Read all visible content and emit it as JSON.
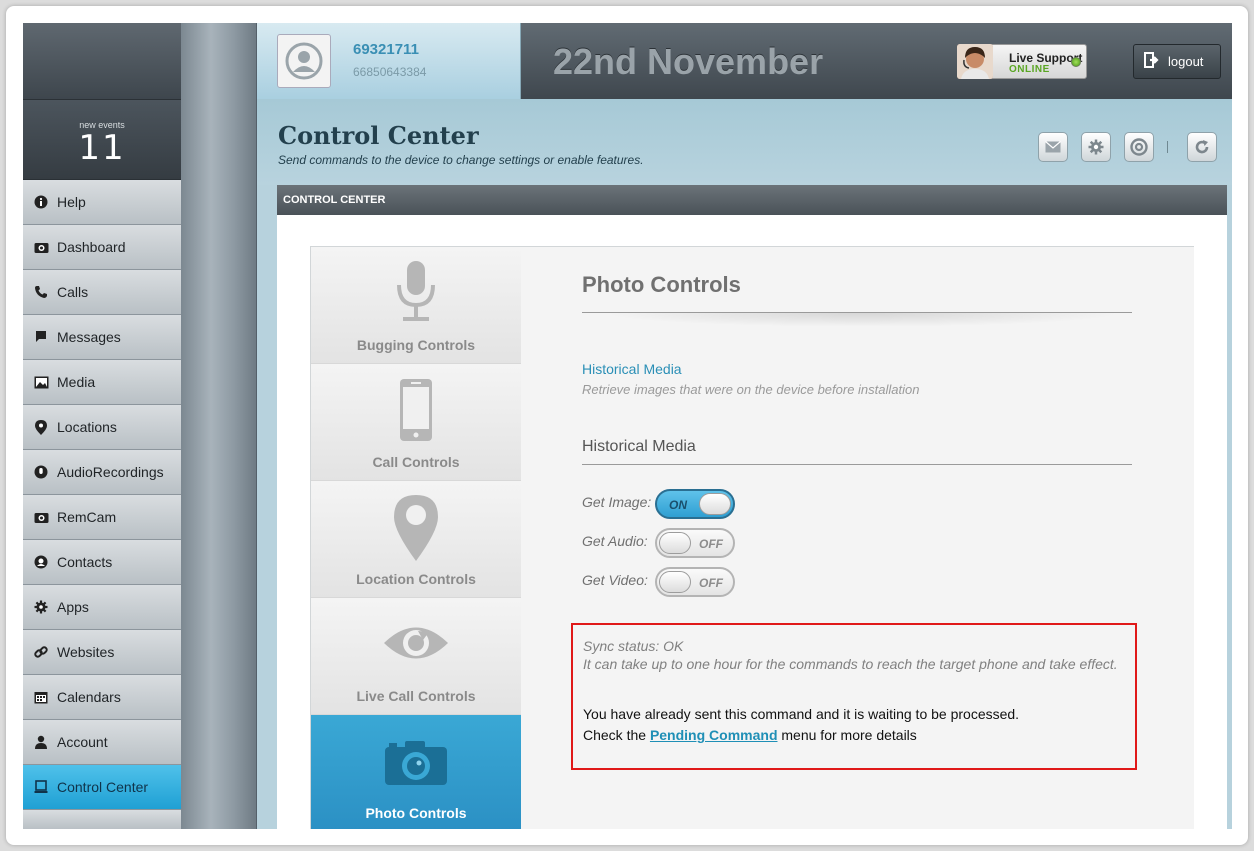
{
  "header": {
    "username": "69321711",
    "phone": "66850643384",
    "date_title": "22nd November",
    "support_line1": "Live Support",
    "support_line2": "ONLINE",
    "logout_label": "logout"
  },
  "sidebar": {
    "events_label": "new events",
    "events_count": "11",
    "items": [
      {
        "label": "Help",
        "icon": "info-icon"
      },
      {
        "label": "Dashboard",
        "icon": "camera-icon"
      },
      {
        "label": "Calls",
        "icon": "phone-icon"
      },
      {
        "label": "Messages",
        "icon": "message-icon"
      },
      {
        "label": "Media",
        "icon": "image-icon"
      },
      {
        "label": "Locations",
        "icon": "pin-icon"
      },
      {
        "label": "AudioRecordings",
        "icon": "mic-icon"
      },
      {
        "label": "RemCam",
        "icon": "camera-icon"
      },
      {
        "label": "Contacts",
        "icon": "contact-icon"
      },
      {
        "label": "Apps",
        "icon": "gear-icon"
      },
      {
        "label": "Websites",
        "icon": "link-icon"
      },
      {
        "label": "Calendars",
        "icon": "calendar-icon"
      },
      {
        "label": "Account",
        "icon": "user-icon"
      },
      {
        "label": "Control Center",
        "icon": "monitor-icon"
      }
    ]
  },
  "page": {
    "title": "Control Center",
    "subtitle": "Send commands to the device to change settings or enable features.",
    "panel_title": "CONTROL CENTER"
  },
  "tabs": [
    {
      "label": "Bugging Controls",
      "icon": "microphone-icon"
    },
    {
      "label": "Call Controls",
      "icon": "smartphone-icon"
    },
    {
      "label": "Location Controls",
      "icon": "map-pin-icon"
    },
    {
      "label": "Live Call Controls",
      "icon": "eye-icon"
    },
    {
      "label": "Photo Controls",
      "icon": "camera-icon"
    }
  ],
  "content": {
    "section_title": "Photo Controls",
    "historical_link": "Historical Media",
    "historical_desc": "Retrieve images that were on the device before installation",
    "historical_title": "Historical Media",
    "options": [
      {
        "label": "Get Image:",
        "state": "ON"
      },
      {
        "label": "Get Audio:",
        "state": "OFF"
      },
      {
        "label": "Get Video:",
        "state": "OFF"
      }
    ],
    "notice": {
      "sync_status": "Sync status: OK",
      "sync_note": "It can take up to one hour for the commands to reach the target phone and take effect.",
      "waiting": "You have already sent this command and it is waiting to be processed.",
      "check_prefix": "Check the",
      "check_link": "Pending Command",
      "check_suffix": "menu for more details"
    }
  },
  "colors": {
    "accent": "#2a9fd6",
    "notice_border": "#e01818",
    "support_online": "#5aa623"
  }
}
